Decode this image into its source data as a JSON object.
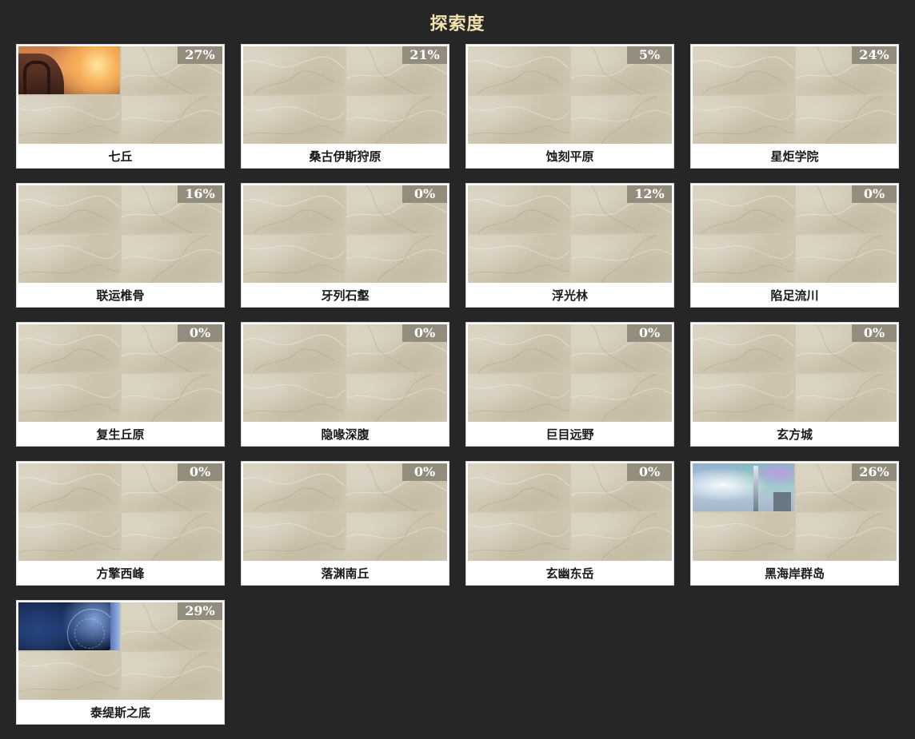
{
  "page": {
    "title": "探索度"
  },
  "regions": [
    {
      "name": "七丘",
      "percent": "27%",
      "photo": "sunset"
    },
    {
      "name": "桑古伊斯狩原",
      "percent": "21%",
      "photo": ""
    },
    {
      "name": "蚀刻平原",
      "percent": "5%",
      "photo": ""
    },
    {
      "name": "星炬学院",
      "percent": "24%",
      "photo": ""
    },
    {
      "name": "联运椎骨",
      "percent": "16%",
      "photo": ""
    },
    {
      "name": "牙列石壑",
      "percent": "0%",
      "photo": ""
    },
    {
      "name": "浮光林",
      "percent": "12%",
      "photo": ""
    },
    {
      "name": "陷足流川",
      "percent": "0%",
      "photo": ""
    },
    {
      "name": "复生丘原",
      "percent": "0%",
      "photo": ""
    },
    {
      "name": "隐喙深腹",
      "percent": "0%",
      "photo": ""
    },
    {
      "name": "巨目远野",
      "percent": "0%",
      "photo": ""
    },
    {
      "name": "玄方城",
      "percent": "0%",
      "photo": ""
    },
    {
      "name": "方擎西峰",
      "percent": "0%",
      "photo": ""
    },
    {
      "name": "落渊南丘",
      "percent": "0%",
      "photo": ""
    },
    {
      "name": "玄幽东岳",
      "percent": "0%",
      "photo": ""
    },
    {
      "name": "黑海岸群岛",
      "percent": "26%",
      "photo": "sky"
    },
    {
      "name": "泰缇斯之底",
      "percent": "29%",
      "photo": "night"
    }
  ]
}
